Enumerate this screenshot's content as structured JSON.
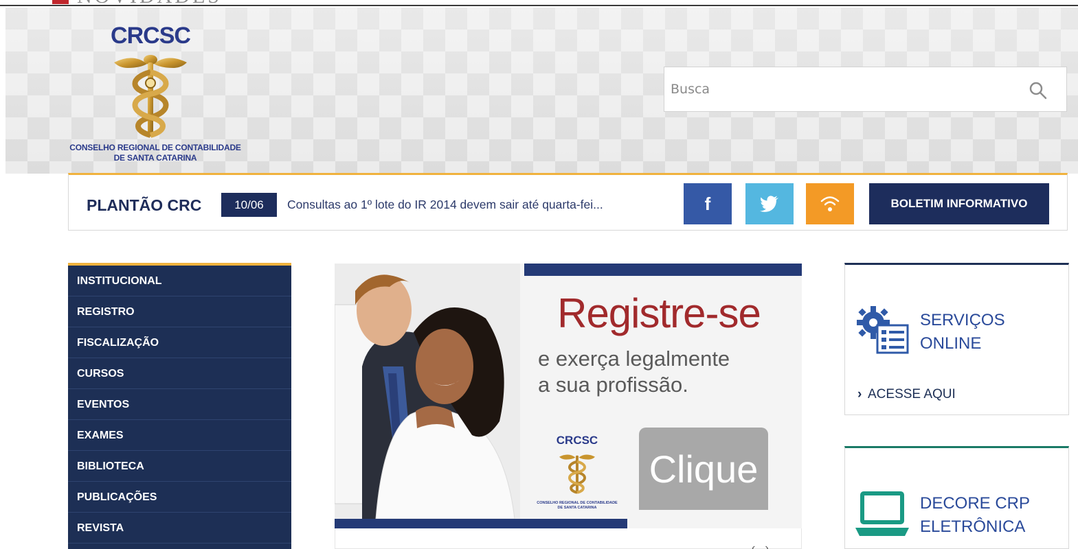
{
  "top_strip": {
    "title": "NOVIDADES"
  },
  "header": {
    "logo_abbr": "CRCSC",
    "logo_line1": "CONSELHO REGIONAL DE CONTABILIDADE",
    "logo_line2": "DE SANTA CATARINA",
    "search": {
      "placeholder": "Busca",
      "value": ""
    }
  },
  "plantao": {
    "title": "PLANTÃO CRC",
    "date": "10/06",
    "news": "Consultas ao 1º lote do IR 2014 devem sair até quarta-fei...",
    "social": {
      "facebook": "f",
      "twitter_icon": "twitter-bird-icon",
      "rss_icon": "wifi-rss-icon"
    },
    "boletim_label": "BOLETIM INFORMATIVO"
  },
  "menu": {
    "items": [
      "INSTITUCIONAL",
      "REGISTRO",
      "FISCALIZAÇÃO",
      "CURSOS",
      "EVENTOS",
      "EXAMES",
      "BIBLIOTECA",
      "PUBLICAÇÕES",
      "REVISTA"
    ]
  },
  "banner": {
    "headline": "Registre-se",
    "sub_line1": "e exerça legalmente",
    "sub_line2": "a sua profissão.",
    "logo_abbr": "CRCSC",
    "logo_line1": "CONSELHO REGIONAL DE CONTABILIDADE",
    "logo_line2": "DE SANTA CATARINA",
    "button_label": "Clique"
  },
  "right": {
    "servicos": {
      "title_line1": "SERVIÇOS",
      "title_line2": "ONLINE",
      "link": "ACESSE AQUI"
    },
    "decore": {
      "title_line1": "DECORE CRP",
      "title_line2": "ELETRÔNICA"
    }
  },
  "colors": {
    "navy": "#1d2f55",
    "gold": "#f0b23d",
    "facebook": "#3559a6",
    "twitter": "#54b7e0",
    "rss": "#f39a26",
    "headline_red": "#a12a2c",
    "teal": "#1a7a66"
  }
}
